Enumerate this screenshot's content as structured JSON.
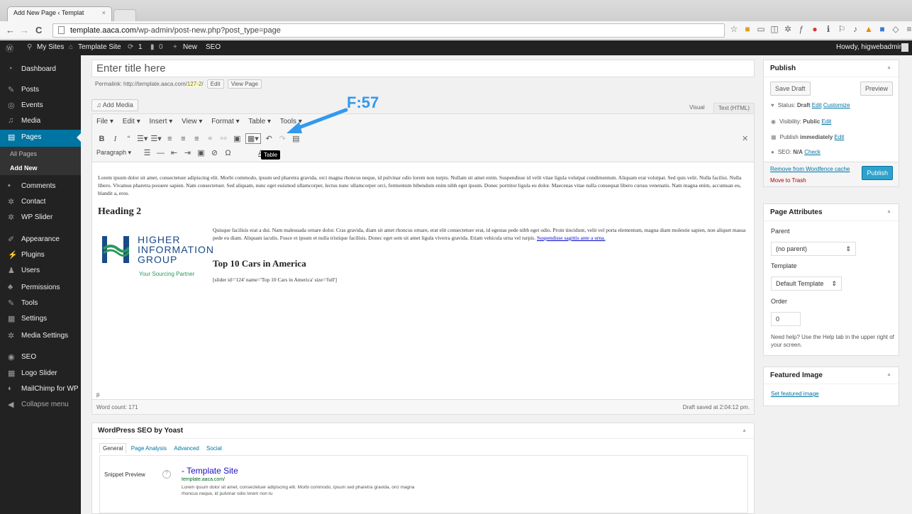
{
  "browser": {
    "tab_title": "Add New Page ‹ Templat",
    "tab_close": "×",
    "url_host": "template.aaca.com",
    "url_path": "/wp-admin/post-new.php?post_type=page",
    "back": "←",
    "forward": "→",
    "reload": "C"
  },
  "adminbar": {
    "wp_logo": "Ⓦ",
    "my_sites": "My Sites",
    "site_name": "Template Site",
    "updates": "1",
    "comments": "0",
    "new": "New",
    "seo": "SEO",
    "howdy": "Howdy, higwebadmin"
  },
  "sidebar": {
    "items": [
      {
        "label": "Dashboard",
        "icon": "dashboard-icon"
      },
      {
        "label": "Posts",
        "icon": "pin-icon"
      },
      {
        "label": "Events",
        "icon": "events-icon"
      },
      {
        "label": "Media",
        "icon": "media-icon"
      },
      {
        "label": "Pages",
        "icon": "pages-icon"
      },
      {
        "label": "Comments",
        "icon": "comment-icon"
      },
      {
        "label": "Contact",
        "icon": "contact-icon"
      },
      {
        "label": "WP Slider",
        "icon": "slider-icon"
      },
      {
        "label": "Appearance",
        "icon": "brush-icon"
      },
      {
        "label": "Plugins",
        "icon": "plug-icon"
      },
      {
        "label": "Users",
        "icon": "users-icon"
      },
      {
        "label": "Permissions",
        "icon": "permissions-icon"
      },
      {
        "label": "Tools",
        "icon": "wrench-icon"
      },
      {
        "label": "Settings",
        "icon": "settings-icon"
      },
      {
        "label": "Media Settings",
        "icon": "gear-icon"
      },
      {
        "label": "SEO",
        "icon": "seo-icon"
      },
      {
        "label": "Logo Slider",
        "icon": "logo-slider-icon"
      },
      {
        "label": "MailChimp for WP",
        "icon": "mailchimp-icon"
      },
      {
        "label": "Collapse menu",
        "icon": "collapse-icon"
      }
    ],
    "sub": {
      "all_pages": "All Pages",
      "add_new": "Add New"
    }
  },
  "editor": {
    "title_placeholder": "Enter title here",
    "permalink_label": "Permalink:",
    "permalink_base": "http://template.aaca.com/",
    "permalink_slug": "127-2",
    "permalink_end": "/",
    "edit_btn": "Edit",
    "view_page_btn": "View Page",
    "add_media": "Add Media",
    "tab_visual": "Visual",
    "tab_text": "Text (HTML)",
    "menus": [
      "File ▾",
      "Edit ▾",
      "Insert ▾",
      "View ▾",
      "Format ▾",
      "Table ▾",
      "Tools ▾"
    ],
    "format_select": "Paragraph",
    "tooltip": "Table",
    "annotation": "F:57",
    "para1": "Lorem ipsum dolor sit amet, consectetuer adipiscing elit. Morbi commodo, ipsum sed pharetra gravida, orci magna rhoncus neque, id pulvinar odio lorem non turpis. Nullam sit amet enim. Suspendisse id velit vitae ligula volutpat condimentum. Aliquam erat volutpat. Sed quis velit. Nulla facilisi. Nulla libero. Vivamus pharetra posuere sapien. Nam consectetuer. Sed aliquam, nunc eget euismod ullamcorper, lectus nunc ullamcorper orci, fermentum bibendum enim nibh eget ipsum. Donec porttitor ligula eu dolor. Maecenas vitae nulla consequat libero cursus venenatis. Nam magna enim, accumsan eu, blandit a, eros.",
    "heading2": "Heading 2",
    "para2": "Quisque facilisis erat a dui. Nam malesuada ornare dolor. Cras gravida, diam sit amet rhoncus ornare, erat elit consectetuer erat, id egestas pede nibh eget odio. Proin tincidunt, velit vel porta elementum, magna diam molestie sapien, non aliquet massa pede eu diam. Aliquam iaculis. Fusce et ipsum et nulla tristique facilisis. Donec eget sem sit amet ligula viverra gravida. Etiam vehicula urna vel turpis.",
    "para2_link": "Suspendisse sagittis ante a urna.",
    "heading3": "Top 10 Cars in America",
    "shortcode": "[slider id='124' name='Top 10 Cars in America' size='full']",
    "logo": {
      "line1": "HIGHER",
      "line2": "INFORMATION",
      "line3": "GROUP",
      "tagline": "Your Sourcing Partner"
    },
    "path": "p",
    "word_count": "Word count: 171",
    "draft_saved": "Draft saved at 2:04:12 pm."
  },
  "seo": {
    "title": "WordPress SEO by Yoast",
    "tabs": [
      "General",
      "Page Analysis",
      "Advanced",
      "Social"
    ],
    "snippet_label": "Snippet Preview",
    "help": "?",
    "snippet_title": "- Template Site",
    "snippet_url": "template.aaca.com/",
    "snippet_desc": "Lorem ipsum dolor sit amet, consectetuer adipiscing elit. Morbi commodo, ipsum sed pharetra gravida, orci magna rhoncus neque, id pulvinar odio lorem non tu"
  },
  "publish": {
    "title": "Publish",
    "save_draft": "Save Draft",
    "preview": "Preview",
    "status_label": "Status:",
    "status_value": "Draft",
    "status_edit": "Edit",
    "status_customize": "Customize",
    "visibility_label": "Visibility:",
    "visibility_value": "Public",
    "visibility_edit": "Edit",
    "publish_label": "Publish",
    "publish_value": "immediately",
    "publish_edit": "Edit",
    "seo_label": "SEO:",
    "seo_value": "N/A",
    "seo_check": "Check",
    "wordfence": "Remove from Wordfence cache",
    "trash": "Move to Trash",
    "publish_btn": "Publish"
  },
  "attributes": {
    "title": "Page Attributes",
    "parent_label": "Parent",
    "parent_value": "(no parent)",
    "template_label": "Template",
    "template_value": "Default Template",
    "order_label": "Order",
    "order_value": "0",
    "help": "Need help? Use the Help tab in the upper right of your screen."
  },
  "featured": {
    "title": "Featured Image",
    "link": "Set featured image"
  },
  "colors": {
    "accent": "#0074a2",
    "adminbar": "#222222",
    "annotation": "#3399ee"
  }
}
